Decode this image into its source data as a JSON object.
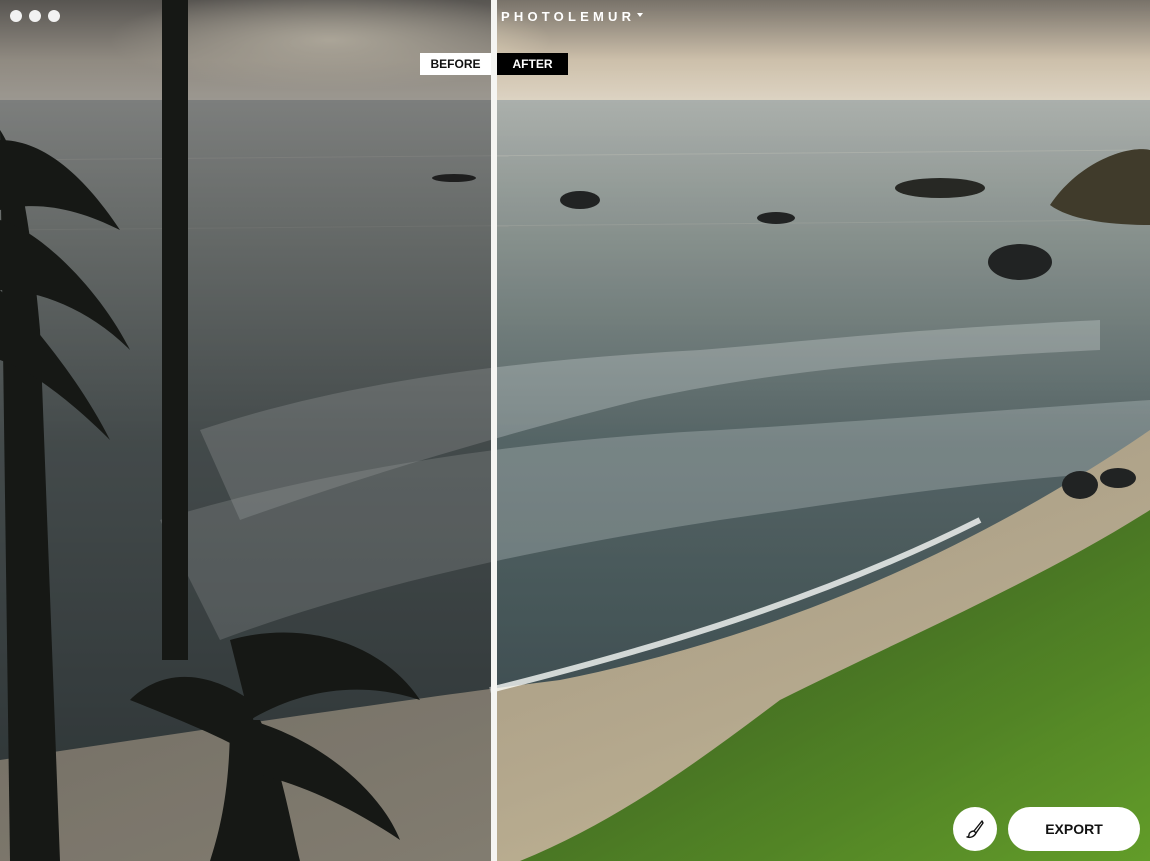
{
  "window": {
    "traffic_lights": [
      "close",
      "minimize",
      "zoom"
    ]
  },
  "app": {
    "brand": "PHOTOLEMUR"
  },
  "compare": {
    "before_label": "BEFORE",
    "after_label": "AFTER"
  },
  "actions": {
    "edit_icon": "brush-icon",
    "export_label": "EXPORT"
  },
  "colors": {
    "overlay_light": "#ffffff",
    "overlay_dark": "#000000",
    "divider": "#f5f5f2"
  }
}
